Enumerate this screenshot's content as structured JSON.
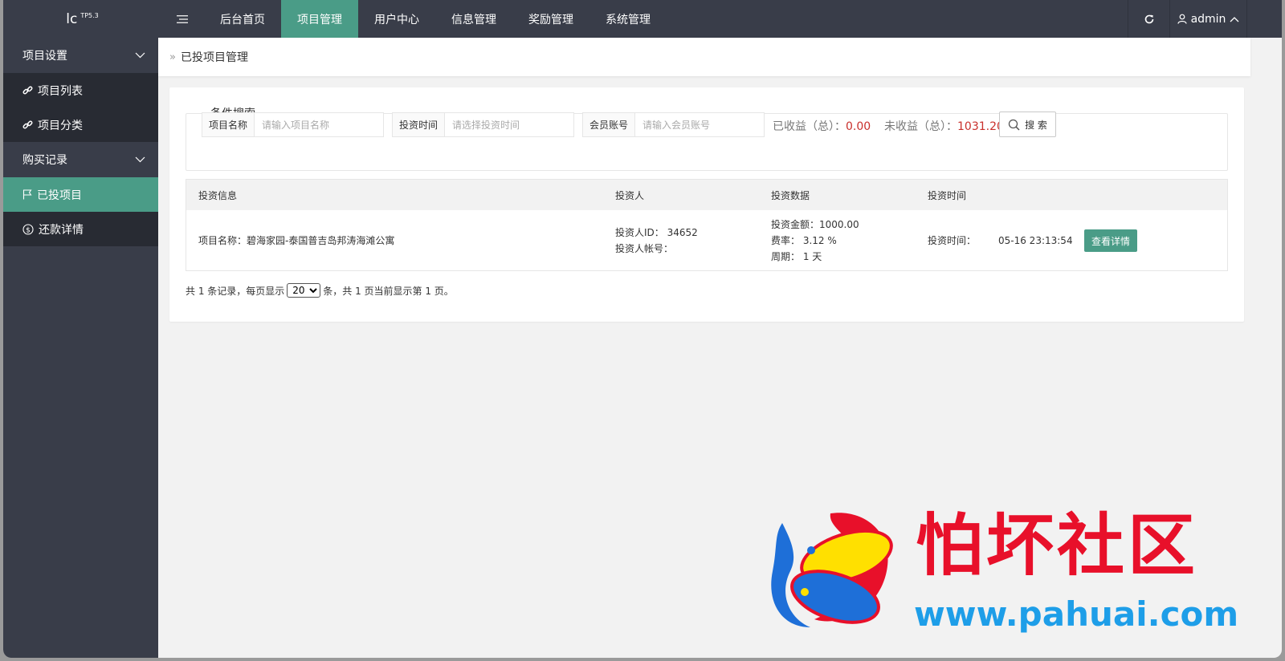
{
  "brand": {
    "name": "lc",
    "version": "TP5.3"
  },
  "topnav": {
    "items": [
      {
        "label": "后台首页",
        "active": false
      },
      {
        "label": "项目管理",
        "active": true
      },
      {
        "label": "用户中心",
        "active": false
      },
      {
        "label": "信息管理",
        "active": false
      },
      {
        "label": "奖励管理",
        "active": false
      },
      {
        "label": "系统管理",
        "active": false
      }
    ],
    "user": "admin"
  },
  "sidebar": {
    "groups": [
      {
        "label": "项目设置",
        "items": [
          {
            "label": "项目列表",
            "icon": "link-icon"
          },
          {
            "label": "项目分类",
            "icon": "link-icon"
          }
        ]
      },
      {
        "label": "购买记录",
        "items": [
          {
            "label": "已投项目",
            "icon": "flag-icon",
            "active": true
          },
          {
            "label": "还款详情",
            "icon": "dollar-icon"
          }
        ]
      }
    ]
  },
  "breadcrumb": {
    "sep": "»",
    "title": "已投项目管理"
  },
  "search": {
    "legend": "条件搜索",
    "fields": [
      {
        "label": "项目名称",
        "placeholder": "请输入项目名称"
      },
      {
        "label": "投资时间",
        "placeholder": "请选择投资时间"
      },
      {
        "label": "会员账号",
        "placeholder": "请输入会员账号"
      }
    ],
    "earned_label": "已收益（总）：",
    "earned_value": "0.00",
    "pending_label": "未收益（总）：",
    "pending_value": "1031.20",
    "button": "搜 索"
  },
  "table": {
    "headers": [
      "投资信息",
      "投资人",
      "投资数据",
      "投资时间"
    ],
    "rows": [
      {
        "project": "项目名称：碧海家园-泰国普吉岛邦涛海滩公寓",
        "investor_id": "投资人ID：  34652",
        "investor_account": "投资人帐号：",
        "amount": "投资金额：1000.00",
        "rate": "费率：  3.12 %",
        "period": "周期：  1 天",
        "time_label": "投资时间：",
        "time_value": "05-16 23:13:54",
        "action": "查看详情"
      }
    ]
  },
  "pager": {
    "prefix": "共 1 条记录，每页显示",
    "page_size": "20",
    "suffix": "条，共 1 页当前显示第 1 页。"
  },
  "watermark": {
    "text": "怕坏社区",
    "url": "www.pahuai.com"
  },
  "colors": {
    "topbar": "#393d49",
    "accent": "#4a9c87",
    "value_red": "#c9302c"
  }
}
